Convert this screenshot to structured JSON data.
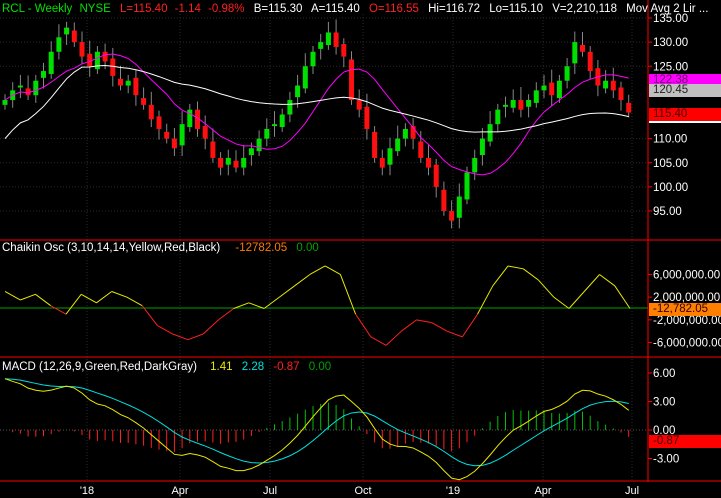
{
  "header": {
    "symbol": "RCL - Weekly",
    "exchange": "NYSE",
    "last": "L=115.40",
    "change": "-1.14",
    "change_pct": "-0.98%",
    "bid": "B=115.30",
    "ask": "A=115.40",
    "open": "O=116.55",
    "high": "Hi=116.72",
    "low": "Lo=115.10",
    "volume": "V=2,210,118",
    "ma": "Mov Avg 2 Lir ..."
  },
  "price_axis": [
    "135.00",
    "130.00",
    "125.00",
    "110.00",
    "105.00",
    "100.00",
    "95.00"
  ],
  "price_tags": {
    "ma_fast": "122.38",
    "ma_slow": "120.45",
    "last": "115.40"
  },
  "chaikin": {
    "label": "Chaikin Osc (3,10,14,14,Yellow,Red,Black)",
    "value": "-12782.05",
    "zero": "0.00",
    "tag": "-12,782.05",
    "axis": [
      "6,000,000.00",
      "2,000,000.00",
      "-2,000,000.00",
      "-6,000,000.00"
    ]
  },
  "macd": {
    "label": "MACD (12,26,9,Green,Red,DarkGray)",
    "macd": "1.41",
    "signal": "2.28",
    "hist": "-0.87",
    "zero": "0.00",
    "tag": "-0.87",
    "axis": [
      "6.00",
      "3.00",
      "0.00",
      "-3.00"
    ]
  },
  "x_axis": [
    "'18",
    "Apr",
    "Jul",
    "Oct",
    "'19",
    "Apr",
    "Jul"
  ],
  "colors": {
    "up": "#00e000",
    "down": "#ff1010",
    "ma_fast": "#ff00ff",
    "ma_slow": "#ffffff",
    "grid": "#2a2a2a",
    "divider": "#ff0000"
  },
  "chart_data": {
    "type": "candlestick",
    "closes": [
      118,
      120,
      121,
      119,
      122,
      124,
      128,
      131,
      133,
      130,
      127,
      125,
      128,
      126,
      123,
      121,
      122,
      119,
      117,
      114,
      112,
      110,
      108,
      113,
      116,
      112,
      110,
      106,
      104,
      106,
      104,
      106,
      108,
      110,
      112,
      113,
      115,
      118,
      121,
      125,
      128,
      130,
      132,
      129,
      127,
      118,
      116,
      112,
      106,
      104,
      108,
      110,
      112,
      110,
      106,
      104,
      100,
      95,
      93,
      98,
      103,
      106,
      110,
      113,
      116,
      117,
      118,
      116,
      118,
      120,
      121,
      119,
      122,
      125,
      130,
      128,
      124,
      121,
      122,
      120,
      118,
      115.4
    ],
    "chaikin_millions": [
      3,
      1.5,
      2.5,
      0.5,
      -1,
      2.5,
      1,
      3,
      2,
      0.5,
      -3,
      -4.5,
      -5.5,
      -4.5,
      -2,
      0,
      1,
      0,
      2,
      4,
      6,
      7.5,
      6,
      -1,
      -5,
      -6.5,
      -4,
      -2,
      -2.5,
      -4,
      -5,
      -1,
      4,
      7.5,
      7,
      5,
      2,
      0,
      3,
      6,
      4,
      0
    ],
    "price_range": [
      92,
      136
    ]
  }
}
